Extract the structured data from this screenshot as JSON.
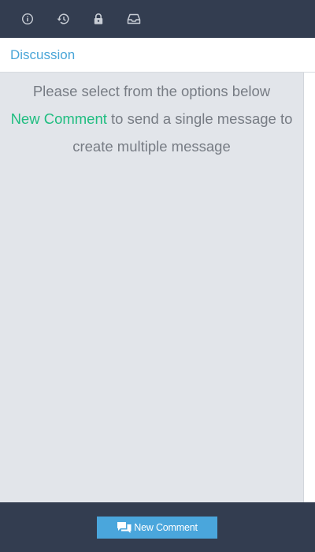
{
  "toolbar": {
    "icons": [
      "info-icon",
      "history-icon",
      "lock-icon",
      "inbox-icon"
    ]
  },
  "header": {
    "title": "Discussion"
  },
  "main": {
    "line1": "Please select from the options below",
    "highlight": "New Comment",
    "line2_rest": " to send a single message to",
    "line3": "create multiple message"
  },
  "footer": {
    "button_label": "New Comment",
    "button_icon": "comments-icon"
  },
  "colors": {
    "toolbar_bg": "#333d50",
    "accent_blue": "#4aa6d8",
    "highlight_green": "#1fbd80",
    "content_bg": "#e2e5ea",
    "text_gray": "#777c84"
  }
}
